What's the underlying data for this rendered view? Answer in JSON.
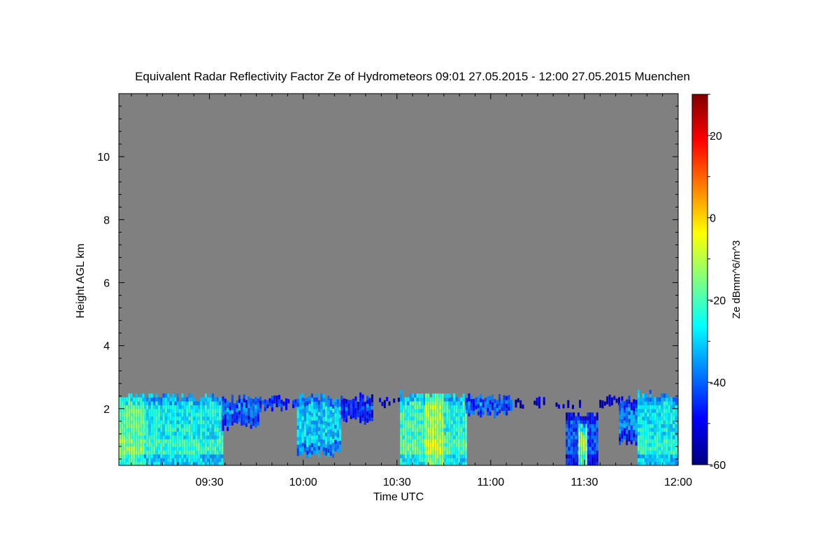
{
  "chart_data": {
    "type": "heatmap",
    "title": "Equivalent Radar Reflectivity Factor Ze of Hydrometeors   09:01 27.05.2015 - 12:00 27.05.2015 Muenchen",
    "xlabel": "Time UTC",
    "ylabel": "Height AGL km",
    "x_range_minutes": [
      541,
      720
    ],
    "x_ticks": [
      {
        "label": "09:30",
        "minutes": 570
      },
      {
        "label": "10:00",
        "minutes": 600
      },
      {
        "label": "10:30",
        "minutes": 630
      },
      {
        "label": "11:00",
        "minutes": 660
      },
      {
        "label": "11:30",
        "minutes": 690
      },
      {
        "label": "12:00",
        "minutes": 720
      }
    ],
    "ylim": [
      0.2,
      12
    ],
    "y_ticks": [
      2,
      4,
      6,
      8,
      10
    ],
    "background_color": "#808080",
    "colorbar": {
      "label": "Ze dBmm^6/m^3",
      "range": [
        -60,
        30
      ],
      "ticks": [
        20,
        0,
        -20,
        -40,
        -60
      ],
      "colormap": "jet"
    },
    "echo_regions": [
      {
        "start": 541,
        "end": 549,
        "base": 0.2,
        "top": 2.5,
        "ze": -18
      },
      {
        "start": 549,
        "end": 574,
        "base": 0.2,
        "top": 2.45,
        "ze": -26
      },
      {
        "start": 574,
        "end": 586,
        "base": 1.3,
        "top": 2.4,
        "ze": -36
      },
      {
        "start": 586,
        "end": 598,
        "base": 1.9,
        "top": 2.4,
        "ze": -38
      },
      {
        "start": 598,
        "end": 612,
        "base": 0.4,
        "top": 2.45,
        "ze": -30
      },
      {
        "start": 612,
        "end": 622,
        "base": 1.5,
        "top": 2.4,
        "ze": -40
      },
      {
        "start": 622,
        "end": 631,
        "base": 2.0,
        "top": 2.3,
        "ze": -45
      },
      {
        "start": 631,
        "end": 639,
        "base": 0.2,
        "top": 2.5,
        "ze": -22
      },
      {
        "start": 639,
        "end": 645,
        "base": 0.2,
        "top": 2.5,
        "ze": -12
      },
      {
        "start": 645,
        "end": 652,
        "base": 0.2,
        "top": 2.5,
        "ze": -24
      },
      {
        "start": 652,
        "end": 667,
        "base": 1.7,
        "top": 2.45,
        "ze": -34
      },
      {
        "start": 667,
        "end": 677,
        "base": 2.0,
        "top": 2.3,
        "ze": -48
      },
      {
        "start": 677,
        "end": 689,
        "base": 2.0,
        "top": 2.25,
        "ze": -50
      },
      {
        "start": 684,
        "end": 694,
        "base": 0.2,
        "top": 1.9,
        "ze": -42
      },
      {
        "start": 688,
        "end": 691,
        "base": 0.2,
        "top": 1.6,
        "ze": -16
      },
      {
        "start": 694,
        "end": 701,
        "base": 2.0,
        "top": 2.4,
        "ze": -48
      },
      {
        "start": 701,
        "end": 707,
        "base": 0.8,
        "top": 2.35,
        "ze": -38
      },
      {
        "start": 707,
        "end": 720,
        "base": 0.2,
        "top": 2.5,
        "ze": -27
      }
    ]
  }
}
